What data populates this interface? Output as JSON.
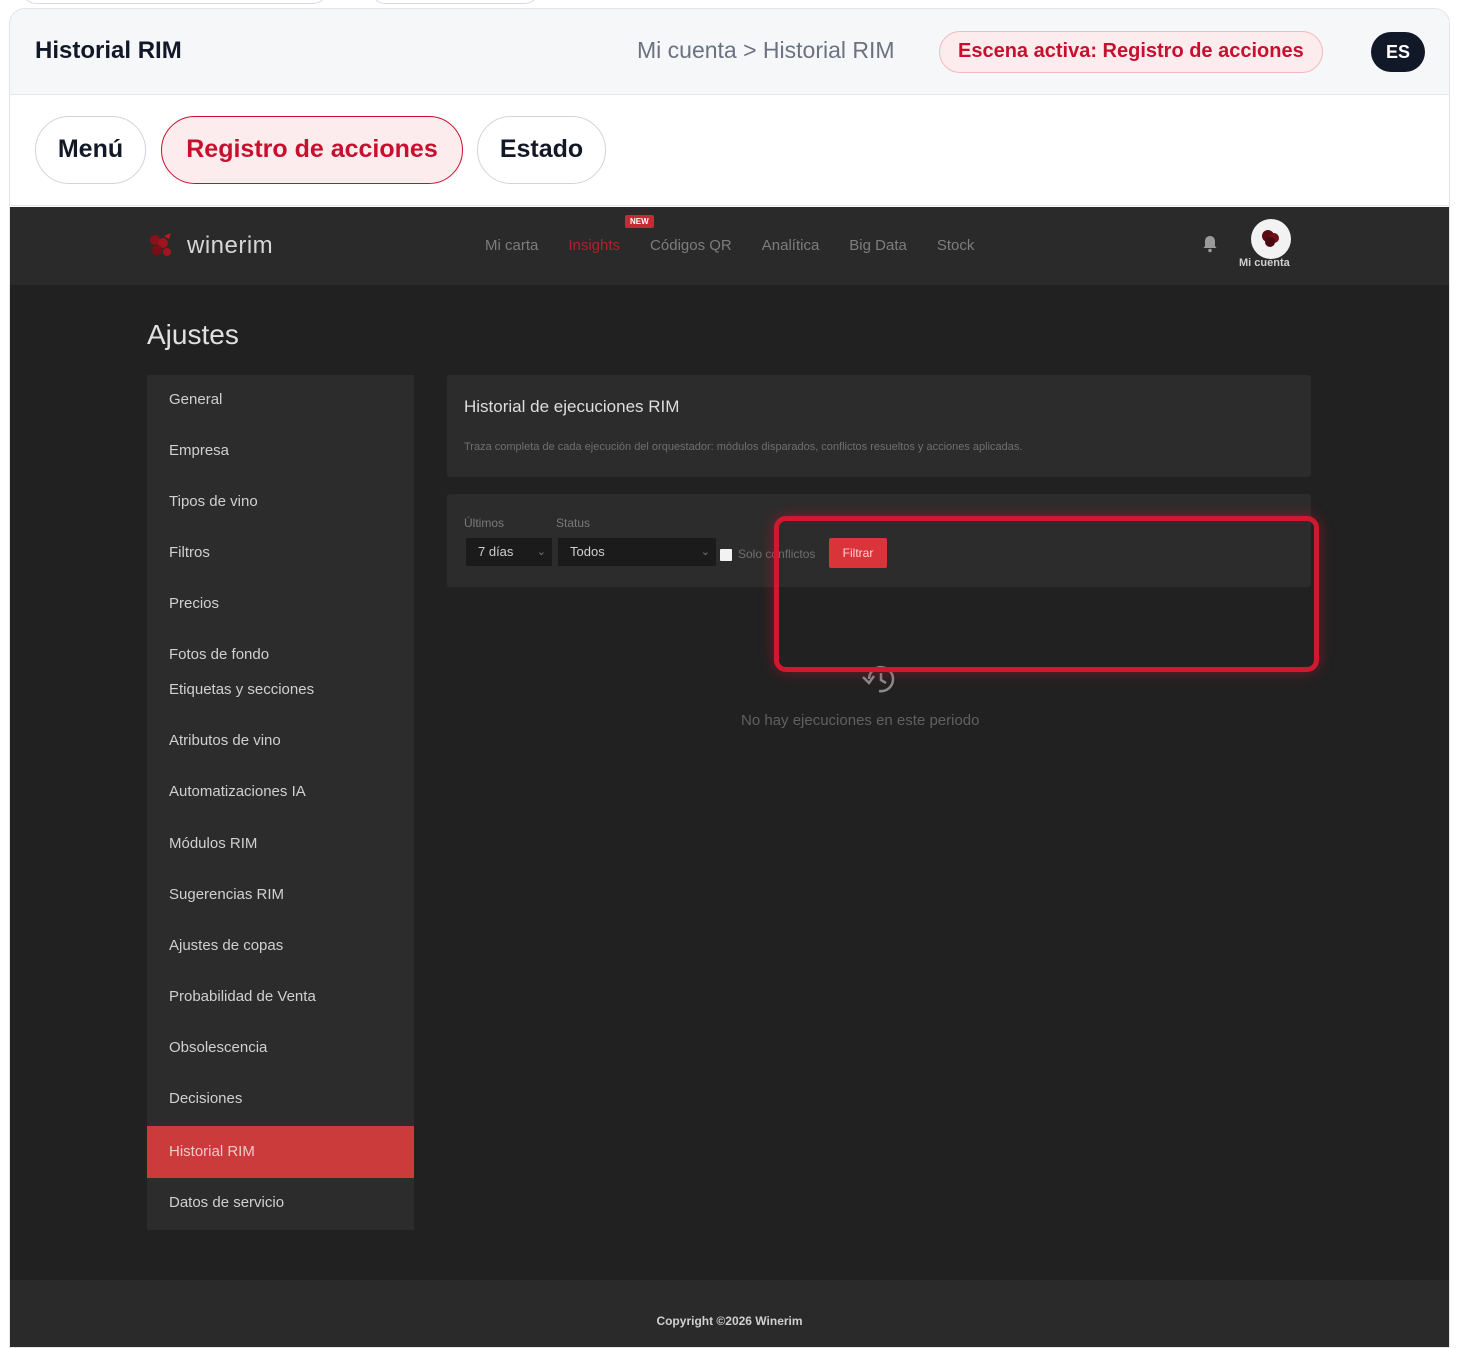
{
  "header": {
    "title": "Historial RIM",
    "breadcrumb": "Mi cuenta > Historial RIM",
    "scene_label": "Escena activa: Registro de acciones",
    "language": "ES"
  },
  "tabs": [
    {
      "label": "Menú",
      "active": false
    },
    {
      "label": "Registro de acciones",
      "active": true
    },
    {
      "label": "Estado",
      "active": false
    }
  ],
  "app": {
    "logo_text": "winerim",
    "nav": {
      "links": [
        "Mi carta",
        "Insights",
        "Códigos QR",
        "Analítica",
        "Big Data",
        "Stock"
      ],
      "new_badge": "NEW",
      "account_label": "Mi cuenta"
    },
    "page_title": "Ajustes",
    "sidebar": {
      "items": [
        "General",
        "Empresa",
        "Tipos de vino",
        "Filtros",
        "Precios",
        "Fotos de fondo",
        "Etiquetas y secciones",
        "Atributos de vino",
        "Automatizaciones IA",
        "Módulos RIM",
        "Sugerencias RIM",
        "Ajustes de copas",
        "Probabilidad de Venta",
        "Obsolescencia",
        "Decisiones",
        "Historial RIM",
        "Datos de servicio"
      ],
      "active_item": "Historial RIM"
    },
    "history_card": {
      "title": "Historial de ejecuciones RIM",
      "description": "Traza completa de cada ejecución del orquestador: módulos disparados, conflictos resueltos y acciones aplicadas."
    },
    "filters": {
      "period_label": "Últimos",
      "period_value": "7 días",
      "status_label": "Status",
      "status_value": "Todos",
      "checkbox_label": "Solo conflictos",
      "button_label": "Filtrar"
    },
    "empty_state": "No hay ejecuciones en este periodo",
    "footer": "Copyright ©2026 Winerim"
  },
  "colors": {
    "accent": "#c8102e",
    "app_background": "#212121",
    "active_sidebar": "#cc3b3b"
  }
}
